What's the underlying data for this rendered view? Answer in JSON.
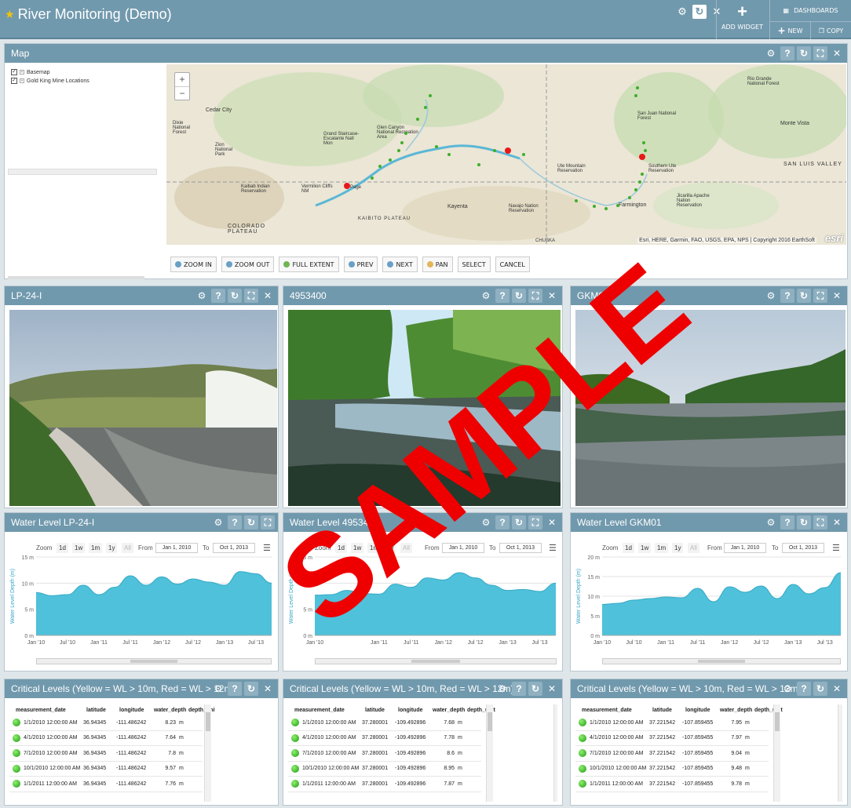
{
  "header": {
    "title": "River Monitoring (Demo)",
    "add_widget": "ADD WIDGET",
    "dashboards": "DASHBOARDS",
    "new": "NEW",
    "copy": "COPY"
  },
  "map": {
    "title": "Map",
    "layers": [
      {
        "label": "Basemap",
        "checked": true
      },
      {
        "label": "Gold King Mine Locations",
        "checked": true
      }
    ],
    "attribution": "Esri, HERE, Garmin, FAO, USGS, EPA, NPS | Copyright 2016 EarthSoft",
    "logo": "esri",
    "place_labels": [
      "Cedar City",
      "Kaibab Indian Reservation",
      "Vermilion Cliffs NM",
      "Grand Staircase-Escalante Natl Mon",
      "Glen Canyon National Recreation Area",
      "Kayenta",
      "Navajo Nation Reservation",
      "Ute Mountain Reservation",
      "Farmington",
      "Southern Ute Reservation",
      "Jicarilla Apache Nation Reservation",
      "Monte Vista",
      "SAN LUIS VALLEY",
      "Rio Grande National Forest",
      "San Juan National Forest",
      "KAIBITO PLATEAU",
      "COLORADO PLATEAU",
      "Zion National Park",
      "Dixie National Forest",
      "Page",
      "CHUSKA"
    ],
    "toolbar": [
      "ZOOM IN",
      "ZOOM OUT",
      "FULL EXTENT",
      "PREV",
      "NEXT",
      "PAN",
      "SELECT",
      "CANCEL"
    ]
  },
  "photos": [
    {
      "title": "LP-24-I"
    },
    {
      "title": "4953400"
    },
    {
      "title": "GKM01"
    }
  ],
  "charts_ui": {
    "zoom_label": "Zoom",
    "zoom_buttons": [
      "1d",
      "1w",
      "1m",
      "1y",
      "All"
    ],
    "from_label": "From",
    "to_label": "To",
    "from_date": "Jan 1, 2010",
    "to_date": "Oct 1, 2013",
    "series_color": "#4fc1da"
  },
  "chart_data": [
    {
      "type": "area",
      "title": "Water Level LP-24-I",
      "ylabel": "Water Level Depth (m)",
      "ylim": [
        0,
        15
      ],
      "y_ticks": [
        "0 m",
        "5 m",
        "10 m",
        "15 m"
      ],
      "x_ticks": [
        "Jan '10",
        "Jul '10",
        "Jan '11",
        "Jul '11",
        "Jan '12",
        "Jul '12",
        "Jan '13",
        "Jul '13"
      ],
      "x": [
        "2010-01",
        "2010-04",
        "2010-07",
        "2010-10",
        "2011-01",
        "2011-04",
        "2011-07",
        "2011-10",
        "2012-01",
        "2012-04",
        "2012-07",
        "2012-10",
        "2013-01",
        "2013-04",
        "2013-07",
        "2013-10"
      ],
      "values": [
        8.2,
        7.6,
        7.8,
        9.6,
        7.8,
        9.2,
        11.4,
        9.6,
        11.2,
        9.8,
        10.8,
        10.2,
        9.6,
        12.2,
        11.8,
        10.0
      ]
    },
    {
      "type": "area",
      "title": "Water Level 4953400",
      "ylabel": "Water Level Depth (m)",
      "ylim": [
        0,
        15
      ],
      "y_ticks": [
        "0 m",
        "5 m",
        "10 m",
        "15 m"
      ],
      "x_ticks": [
        "Jan '10",
        "Jan '11",
        "Jul '11",
        "Jan '12",
        "Jul '12",
        "Jan '13",
        "Jul '13"
      ],
      "x": [
        "2010-01",
        "2010-04",
        "2010-07",
        "2010-10",
        "2011-01",
        "2011-04",
        "2011-07",
        "2011-10",
        "2012-01",
        "2012-04",
        "2012-07",
        "2012-10",
        "2013-01",
        "2013-04",
        "2013-07",
        "2013-10"
      ],
      "values": [
        7.7,
        7.8,
        8.6,
        8.0,
        7.9,
        9.8,
        9.2,
        11.0,
        10.6,
        12.0,
        11.0,
        9.6,
        8.6,
        8.8,
        8.4,
        10.0
      ]
    },
    {
      "type": "area",
      "title": "Water Level GKM01",
      "ylabel": "Water Level Depth (m)",
      "ylim": [
        0,
        20
      ],
      "y_ticks": [
        "0 m",
        "5 m",
        "10 m",
        "15 m",
        "20 m"
      ],
      "x_ticks": [
        "Jan '10",
        "Jul '10",
        "Jan '11",
        "Jul '11",
        "Jan '12",
        "Jul '12",
        "Jan '13",
        "Jul '13"
      ],
      "x": [
        "2010-01",
        "2010-04",
        "2010-07",
        "2010-10",
        "2011-01",
        "2011-04",
        "2011-07",
        "2011-10",
        "2012-01",
        "2012-04",
        "2012-07",
        "2012-10",
        "2013-01",
        "2013-04",
        "2013-07",
        "2013-10"
      ],
      "values": [
        7.9,
        8.2,
        9.0,
        9.4,
        9.8,
        9.6,
        12.0,
        8.6,
        12.4,
        11.0,
        12.6,
        9.4,
        13.0,
        10.6,
        12.2,
        16.0
      ]
    }
  ],
  "tables": [
    {
      "title": "Critical Levels (Yellow = WL > 10m, Red = WL > 12m)",
      "columns": [
        "measurement_date",
        "latitude",
        "longitude",
        "water_depth",
        "depth_unit"
      ],
      "rows": [
        [
          "1/1/2010 12:00:00 AM",
          "36.94345",
          "-111.486242",
          "8.23",
          "m"
        ],
        [
          "4/1/2010 12:00:00 AM",
          "36.94345",
          "-111.486242",
          "7.64",
          "m"
        ],
        [
          "7/1/2010 12:00:00 AM",
          "36.94345",
          "-111.486242",
          "7.8",
          "m"
        ],
        [
          "10/1/2010 12:00:00 AM",
          "36.94345",
          "-111.486242",
          "9.57",
          "m"
        ],
        [
          "1/1/2011 12:00:00 AM",
          "36.94345",
          "-111.486242",
          "7.76",
          "m"
        ]
      ]
    },
    {
      "title": "Critical Levels (Yellow = WL > 10m, Red = WL > 12m)",
      "columns": [
        "measurement_date",
        "latitude",
        "longitude",
        "water_depth",
        "depth_unit"
      ],
      "rows": [
        [
          "1/1/2010 12:00:00 AM",
          "37.280001",
          "-109.492896",
          "7.68",
          "m"
        ],
        [
          "4/1/2010 12:00:00 AM",
          "37.280001",
          "-109.492896",
          "7.78",
          "m"
        ],
        [
          "7/1/2010 12:00:00 AM",
          "37.280001",
          "-109.492896",
          "8.6",
          "m"
        ],
        [
          "10/1/2010 12:00:00 AM",
          "37.280001",
          "-109.492896",
          "8.95",
          "m"
        ],
        [
          "1/1/2011 12:00:00 AM",
          "37.280001",
          "-109.492896",
          "7.87",
          "m"
        ]
      ]
    },
    {
      "title": "Critical Levels (Yellow = WL > 10m, Red = WL > 12m)",
      "columns": [
        "measurement_date",
        "latitude",
        "longitude",
        "water_depth",
        "depth_unit"
      ],
      "rows": [
        [
          "1/1/2010 12:00:00 AM",
          "37.221542",
          "-107.859455",
          "7.95",
          "m"
        ],
        [
          "4/1/2010 12:00:00 AM",
          "37.221542",
          "-107.859455",
          "7.97",
          "m"
        ],
        [
          "7/1/2010 12:00:00 AM",
          "37.221542",
          "-107.859455",
          "9.04",
          "m"
        ],
        [
          "10/1/2010 12:00:00 AM",
          "37.221542",
          "-107.859455",
          "9.48",
          "m"
        ],
        [
          "1/1/2011 12:00:00 AM",
          "37.221542",
          "-107.859455",
          "9.78",
          "m"
        ]
      ]
    }
  ],
  "watermark": "SAMPLE"
}
